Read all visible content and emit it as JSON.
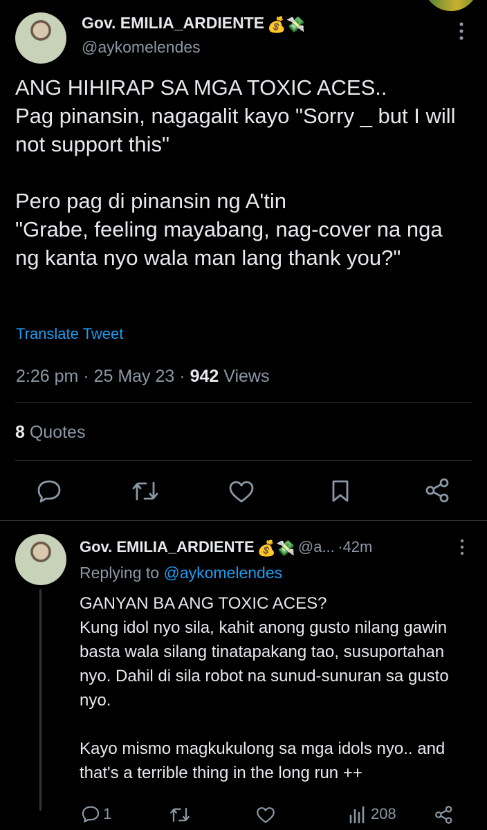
{
  "main_tweet": {
    "author_name": "Gov. EMILIA_ARDIENTE",
    "author_emojis": "💰💸",
    "author_handle": "@aykomelendes",
    "text": "ANG HIHIRAP SA MGA TOXIC ACES..\nPag pinansin, nagagalit kayo \"Sorry _ but I will not support this\"\n\nPero pag di pinansin ng A'tin\n\"Grabe, feeling mayabang, nag-cover na nga ng kanta nyo wala man lang thank you?\"",
    "translate_label": "Translate Tweet",
    "time": "2:26 pm",
    "date": "25 May 23",
    "views_count": "942",
    "views_label": "Views",
    "quotes_count": "8",
    "quotes_label": "Quotes"
  },
  "reply_tweet": {
    "author_name": "Gov. EMILIA_ARDIENTE",
    "author_emojis": "💰💸",
    "author_handle": "@a...",
    "time_ago": "42m",
    "replying_prefix": "Replying to",
    "replying_handle": "@aykomelendes",
    "text": "GANYAN BA ANG TOXIC ACES?\nKung idol nyo sila, kahit anong gusto nilang gawin basta wala silang tinatapakang tao, susuportahan nyo. Dahil di sila robot na sunud-sunuran sa gusto nyo.\n\nKayo mismo magkukulong sa mga idols nyo.. and that's a terrible thing in the long run ++",
    "reply_count": "1",
    "views_count": "208"
  },
  "colors": {
    "background": "#000000",
    "text_primary": "#e7e9ea",
    "text_secondary": "#8b98a5",
    "link": "#1d9bf0",
    "divider": "#2f3336"
  },
  "icons": {
    "more": "more-dots-icon",
    "reply": "reply-icon",
    "retweet": "retweet-icon",
    "like": "like-icon",
    "bookmark": "bookmark-icon",
    "share": "share-icon",
    "views": "views-icon"
  }
}
